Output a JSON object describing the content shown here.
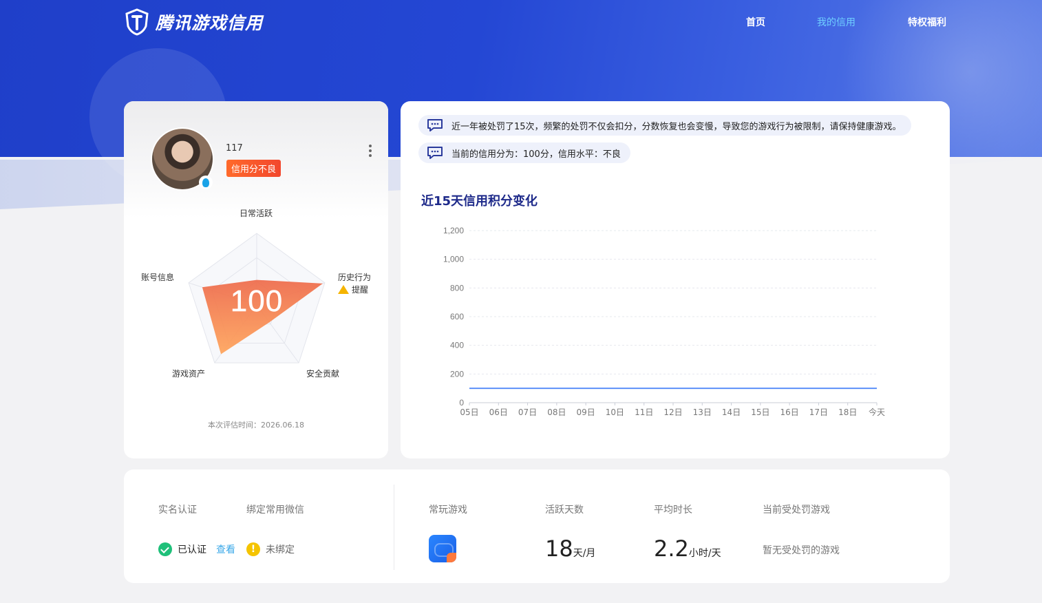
{
  "brand": {
    "name": "腾讯游戏信用"
  },
  "nav": [
    {
      "label": "首页",
      "active": false
    },
    {
      "label": "我的信用",
      "active": true
    },
    {
      "label": "特权福利",
      "active": false
    }
  ],
  "profile": {
    "user_id": "117",
    "credit_tag": "信用分不良",
    "score": "100",
    "radar": {
      "axes": [
        "日常活跃",
        "历史行为",
        "安全贡献",
        "游戏资产",
        "账号信息"
      ],
      "values": [
        0.35,
        0.97,
        0.3,
        0.85,
        0.8
      ],
      "warning": "提醒"
    },
    "eval_time": "本次评估时间：2026.06.18"
  },
  "notices": [
    "近一年被处罚了15次，频繁的处罚不仅会扣分，分数恢复也会变慢，导致您的游戏行为被限制，请保持健康游戏。",
    "当前的信用分为：100分，信用水平：不良"
  ],
  "chart_title": "近15天信用积分变化",
  "chart_data": {
    "type": "line",
    "title": "近15天信用积分变化",
    "categories": [
      "05日",
      "06日",
      "07日",
      "08日",
      "09日",
      "10日",
      "11日",
      "12日",
      "13日",
      "14日",
      "15日",
      "16日",
      "17日",
      "18日",
      "今天"
    ],
    "series": [
      {
        "values": [
          100,
          100,
          100,
          100,
          100,
          100,
          100,
          100,
          100,
          100,
          100,
          100,
          100,
          100,
          100
        ]
      }
    ],
    "y_ticks": [
      "0",
      "200",
      "400",
      "600",
      "800",
      "1,000",
      "1,200"
    ],
    "ylim": [
      0,
      1200
    ],
    "grid": true,
    "line_color": "#5b8ff9"
  },
  "stats": {
    "realname_head": "实名认证",
    "wechat_head": "绑定常用微信",
    "realname_status": "已认证",
    "view_link": "查看",
    "wechat_status": "未绑定",
    "game_head": "常玩游戏",
    "active_head": "活跃天数",
    "active_value": "18",
    "active_unit": "天/月",
    "avg_head": "平均时长",
    "avg_value": "2.2",
    "avg_unit": "小时/天",
    "punish_head": "当前受处罚游戏",
    "punish_value": "暂无受处罚的游戏"
  },
  "colors": {
    "brand_blue": "#2447d4",
    "nav_active": "#6fd0ff",
    "bad_tag": "#f2472d",
    "radar_fill": "#f07a4f",
    "ok_green": "#1fc07a",
    "warn_yellow": "#f5c400",
    "link": "#3aa8e8"
  }
}
